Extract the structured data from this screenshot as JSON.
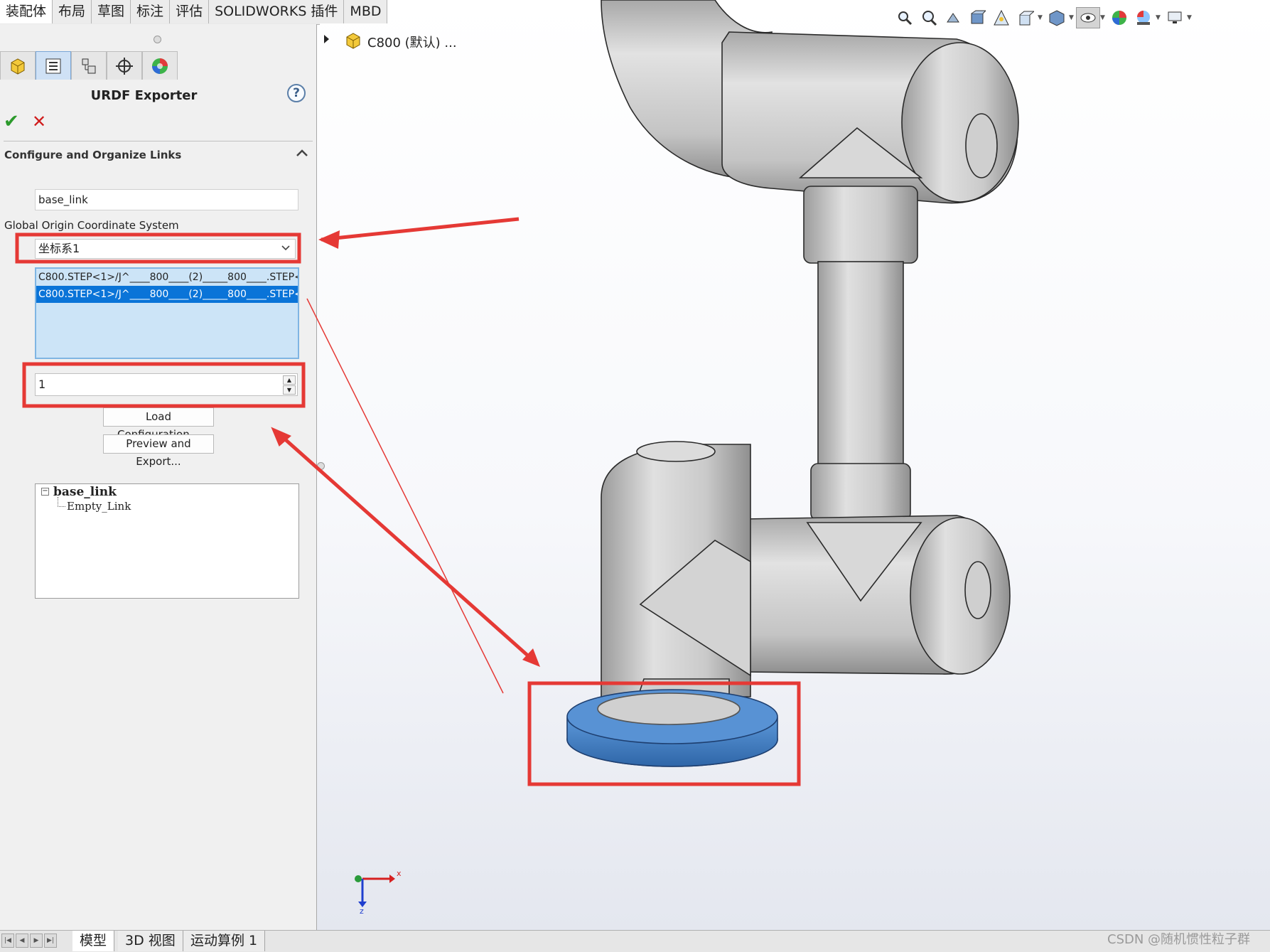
{
  "ribbon": {
    "tabs": [
      "装配体",
      "布局",
      "草图",
      "标注",
      "评估",
      "SOLIDWORKS 插件",
      "MBD"
    ]
  },
  "property_manager": {
    "tab_icons": [
      "feature-manager-icon",
      "property-manager-icon",
      "configuration-manager-icon",
      "dimxpert-icon",
      "display-manager-icon"
    ],
    "title": "URDF Exporter",
    "help_label": "?",
    "ok_label": "✔",
    "cancel_label": "✕",
    "section_title": "Configure and Organize Links",
    "link_name": "base_link",
    "origin_label": "Global Origin Coordinate System",
    "origin_value": "坐标系1",
    "components": [
      "C800.STEP<1>/J^____800____(2)_____800____.STEP<",
      "C800.STEP<1>/J^____800____(2)_____800____.STEP<"
    ],
    "child_count": "1",
    "load_button": "Load Configuration...",
    "preview_button": "Preview and Export...",
    "tree": {
      "root": "base_link",
      "toggle": "−",
      "child": "Empty_Link"
    }
  },
  "model_tree": {
    "item": "C800 (默认) ..."
  },
  "bottom_tabs": [
    "模型",
    "3D 视图",
    "运动算例 1"
  ],
  "watermark": "CSDN @随机惯性粒子群",
  "triad": {
    "x": "x",
    "z": "z"
  },
  "colors": {
    "annotation_red": "#e53935",
    "selection_blue": "#0a74d8",
    "base_part_blue": "#3f7fc8",
    "robot_grey": "#cfcfcf"
  }
}
